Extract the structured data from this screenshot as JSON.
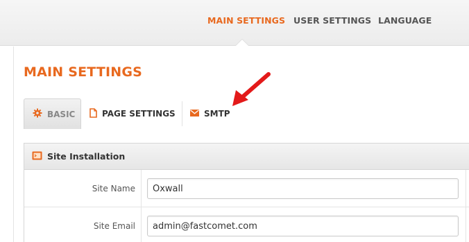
{
  "topnav": {
    "items": [
      {
        "label": "MAIN SETTINGS",
        "active": true
      },
      {
        "label": "USER SETTINGS",
        "active": false
      },
      {
        "label": "LANGUAGE",
        "active": false
      }
    ]
  },
  "page": {
    "title": "MAIN SETTINGS"
  },
  "subtabs": [
    {
      "label": "BASIC",
      "icon": "gear-icon",
      "active": true
    },
    {
      "label": "PAGE SETTINGS",
      "icon": "page-icon",
      "active": false
    },
    {
      "label": "SMTP",
      "icon": "envelope-icon",
      "active": false
    }
  ],
  "section": {
    "title": "Site Installation",
    "fields": [
      {
        "label": "Site Name",
        "value": "Oxwall"
      },
      {
        "label": "Site Email",
        "value": "admin@fastcomet.com"
      }
    ]
  },
  "colors": {
    "accent": "#e8691f",
    "arrow": "#e31a1a"
  }
}
